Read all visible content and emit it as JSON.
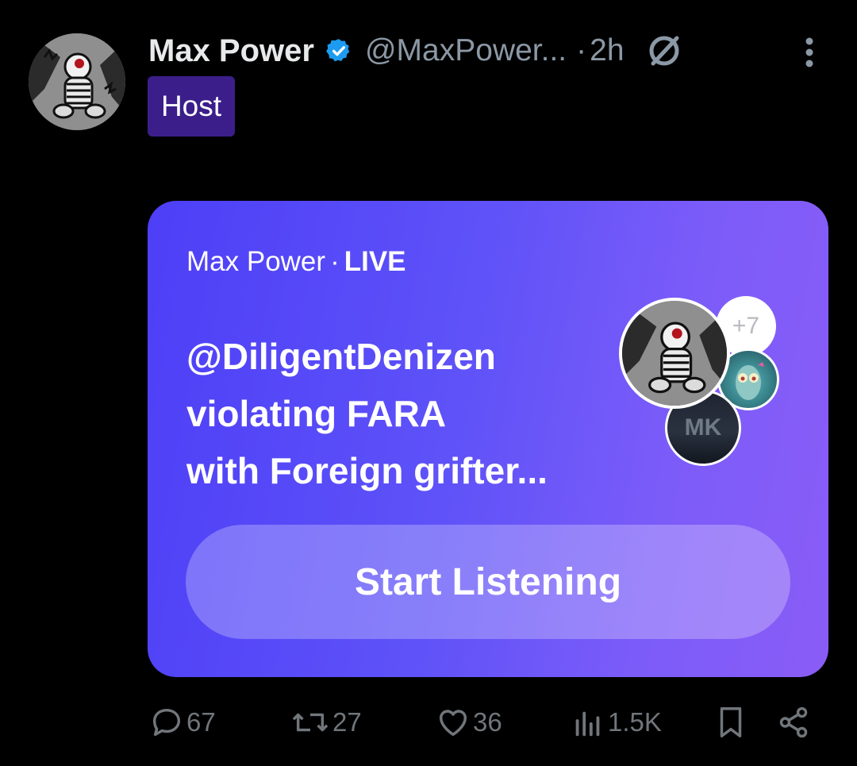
{
  "colors": {
    "background": "#000000",
    "text_primary": "#e7e9ea",
    "text_secondary": "#71767b",
    "verified_blue": "#1d9bf0",
    "host_badge": "#3b1e8a",
    "space_card_start": "#4d3ff7",
    "space_card_end": "#8a5cf6"
  },
  "tweet": {
    "author": {
      "display_name": "Max Power",
      "handle": "@MaxPower...",
      "verified": true,
      "avatar_icon": "avatar-image"
    },
    "separator": "·",
    "timestamp": "2h",
    "reply_restricted_icon": "no-reply-icon",
    "more_icon": "more-vertical-icon",
    "role_badge": "Host"
  },
  "space": {
    "host_name": "Max Power",
    "separator": "·",
    "status": "LIVE",
    "title_lines": [
      "@DiligentDenizen",
      "violating FARA",
      "with Foreign grifter..."
    ],
    "extra_listeners": "+7",
    "speaker_badge_text": "MK",
    "start_button": "Start Listening"
  },
  "actions": {
    "replies": "67",
    "retweets": "27",
    "likes": "36",
    "views": "1.5K"
  }
}
